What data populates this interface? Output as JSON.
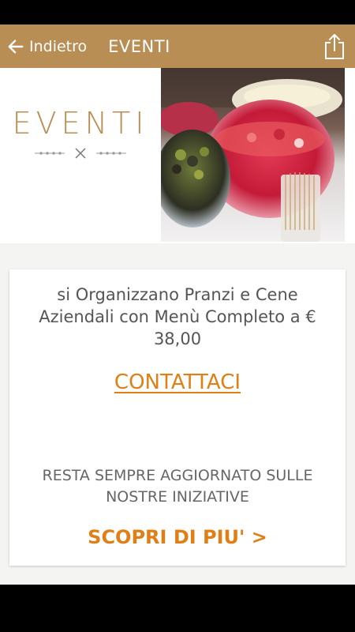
{
  "app_bar": {
    "back_label": "Indietro",
    "title": "EVENTI",
    "back_icon": "arrow-left-icon",
    "share_icon": "share-icon"
  },
  "hero": {
    "logo_text": "EVENTI",
    "ornament_icon": "fork-knife-icon"
  },
  "card": {
    "promo_text": "si Organizzano Pranzi e Cene Aziendali con Menù Completo a € 38,00",
    "contact_label": "CONTATTACI",
    "updates_text": "RESTA SEMPRE AGGIORNATO SULLE NOSTRE INIZIATIVE",
    "discover_label": "SCOPRI DI PIU' >"
  },
  "colors": {
    "app_bar": "#b88e55",
    "accent": "#e07f16",
    "text": "#555555"
  }
}
